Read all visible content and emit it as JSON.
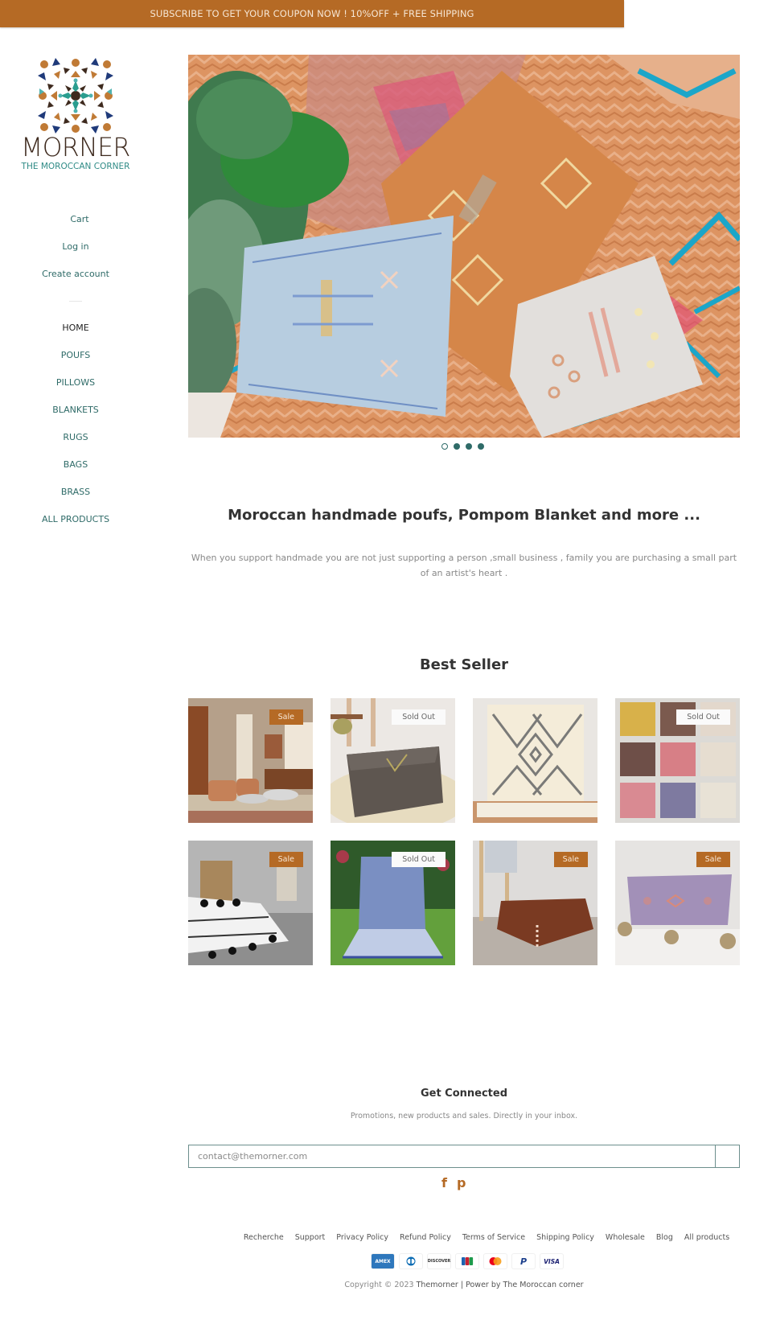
{
  "announcement": "SUBSCRIBE TO GET YOUR COUPON NOW ! 10%OFF + FREE SHIPPING",
  "brand": {
    "name": "MORNER",
    "tagline": "THE MOROCCAN CORNER"
  },
  "account_links": [
    {
      "label": "Cart"
    },
    {
      "label": "Log in"
    },
    {
      "label": "Create account"
    }
  ],
  "nav": [
    {
      "label": "HOME",
      "active": true
    },
    {
      "label": "POUFS"
    },
    {
      "label": "PILLOWS"
    },
    {
      "label": "BLANKETS"
    },
    {
      "label": "RUGS"
    },
    {
      "label": "BAGS"
    },
    {
      "label": "BRASS"
    },
    {
      "label": "ALL PRODUCTS"
    }
  ],
  "slideshow": {
    "slide_count": 4,
    "active_index": 0,
    "image_alt": "Moroccan cactus silk pillows on a colorful Berber rug"
  },
  "intro": {
    "title": "Moroccan handmade poufs, Pompom Blanket and more ...",
    "text": "When you support handmade you are not just supporting a person ,small business , family you are purchasing a small part of an artist's heart ."
  },
  "best_seller": {
    "title": "Best Seller",
    "products": [
      {
        "image": "living room with leather poufs",
        "badge": "Sale"
      },
      {
        "image": "dark kilim floor pouf",
        "badge": "Sold Out"
      },
      {
        "image": "cream beni ourain rug with diamond pattern",
        "badge": ""
      },
      {
        "image": "grid of cactus silk pillows",
        "badge": "Sold Out"
      },
      {
        "image": "white pompom blanket on bed",
        "badge": "Sale"
      },
      {
        "image": "blue handira blanket on grass",
        "badge": "Sold Out"
      },
      {
        "image": "brown leather floor pouf",
        "badge": "Sale"
      },
      {
        "image": "lavender lumbar pillow with pompoms",
        "badge": "Sale"
      }
    ]
  },
  "newsletter": {
    "title": "Get Connected",
    "text": "Promotions, new products and sales. Directly in your inbox.",
    "email_placeholder": "contact@themorner.com",
    "submit_label": ""
  },
  "social": [
    {
      "icon": "facebook-icon",
      "glyph": "f"
    },
    {
      "icon": "pinterest-icon",
      "glyph": "p"
    }
  ],
  "footer_links": [
    {
      "label": "Recherche"
    },
    {
      "label": "Support"
    },
    {
      "label": "Privacy Policy"
    },
    {
      "label": "Refund Policy"
    },
    {
      "label": "Terms of Service"
    },
    {
      "label": "Shipping Policy"
    },
    {
      "label": "Wholesale"
    },
    {
      "label": "Blog"
    },
    {
      "label": "All products"
    }
  ],
  "payments": [
    {
      "name": "amex",
      "label": "AMEX"
    },
    {
      "name": "diners",
      "label": ""
    },
    {
      "name": "discover",
      "label": "DISCOVER"
    },
    {
      "name": "jcb",
      "label": "JCB"
    },
    {
      "name": "mastercard",
      "label": ""
    },
    {
      "name": "paypal",
      "label": "P"
    },
    {
      "name": "visa",
      "label": "VISA"
    }
  ],
  "copyright": {
    "prefix": "Copyright © 2023",
    "store": "Themorner",
    "suffix": "| Power by The Moroccan corner"
  },
  "colors": {
    "accent": "#b56a25",
    "link": "#2f6b68",
    "logo_teal": "#2f8b86",
    "logo_brown": "#3e2a1e"
  }
}
